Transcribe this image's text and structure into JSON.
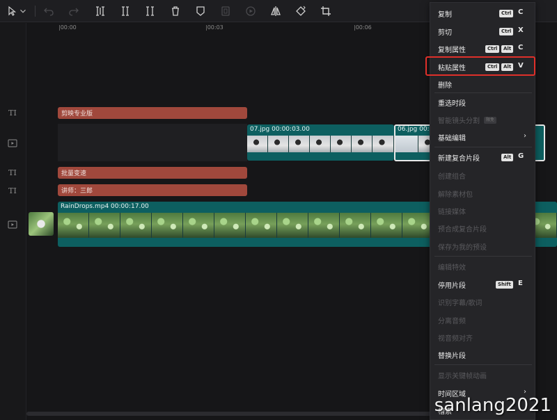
{
  "toolbar": {
    "icons": [
      "pointer-icon",
      "dropdown-icon",
      "undo-icon",
      "redo-icon",
      "split-icon",
      "split-left-icon",
      "split-right-icon",
      "delete-icon",
      "marker-icon",
      "freeze-icon",
      "play-icon",
      "mirror-icon",
      "rotate-icon",
      "crop-icon"
    ]
  },
  "ruler": {
    "t0": "|00:00",
    "t1": "|00:03",
    "t2": "|00:06"
  },
  "tracks": {
    "text1": {
      "icon": "TI",
      "clip": "剪映专业版"
    },
    "video1": {
      "clip1_label": "07.jpg   00:00:03.00",
      "clip2_label": "06.jpg   00:0"
    },
    "text2": {
      "icon": "TI",
      "clip": "批量变速"
    },
    "text3": {
      "icon": "TI",
      "clip": "讲师：三郎"
    },
    "main": {
      "clip_label": "RainDrops.mp4   00:00:17.00"
    }
  },
  "menu": {
    "copy": {
      "label": "复制",
      "kbd1": "Ctrl",
      "key": "C"
    },
    "cut": {
      "label": "剪切",
      "kbd1": "Ctrl",
      "key": "X"
    },
    "copy_attr": {
      "label": "复制属性",
      "kbd1": "Ctrl",
      "kbd2": "Alt",
      "key": "C"
    },
    "paste_attr": {
      "label": "粘贴属性",
      "kbd1": "Ctrl",
      "kbd2": "Alt",
      "key": "V"
    },
    "delete": {
      "label": "删除"
    },
    "reselect": {
      "label": "重选时段"
    },
    "smart_split": {
      "label": "智能镜头分割",
      "badge": "限免"
    },
    "basic_edit": {
      "label": "基础编辑",
      "arrow": "›"
    },
    "new_compound": {
      "label": "新建复合片段",
      "kbd1": "Alt",
      "key": "G"
    },
    "create_group": {
      "label": "创建组合"
    },
    "unpack": {
      "label": "解除素材包"
    },
    "link_media": {
      "label": "链接媒体"
    },
    "precompose": {
      "label": "预合成复合片段"
    },
    "save_preset": {
      "label": "保存为我的预设"
    },
    "edit_effect": {
      "label": "编辑特效"
    },
    "disable_clip": {
      "label": "停用片段",
      "kbd1": "Shift",
      "key": "E"
    },
    "recognize_lyrics": {
      "label": "识别字幕/歌词"
    },
    "separate_audio": {
      "label": "分离音频"
    },
    "av_align": {
      "label": "视音频对齐"
    },
    "replace_clip": {
      "label": "替换片段"
    },
    "show_keyframes": {
      "label": "显示关键帧动画"
    },
    "time_region": {
      "label": "时间区域",
      "arrow": "›"
    },
    "last_item": {
      "label": "槽素"
    }
  },
  "watermark": "sanlang2021",
  "colors": {
    "text_clip": "#a0483c",
    "video_clip": "#0d5f60",
    "highlight": "#e0302a"
  }
}
